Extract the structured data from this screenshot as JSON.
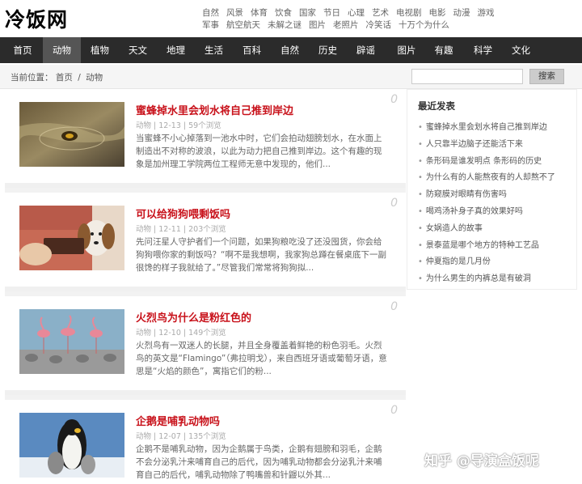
{
  "header": {
    "logo": "冷饭网",
    "top_links": [
      "自然",
      "风景",
      "体育",
      "饮食",
      "国家",
      "节日",
      "心理",
      "艺术",
      "电视剧",
      "电影",
      "动漫",
      "游戏",
      "军事",
      "航空航天",
      "未解之谜",
      "图片",
      "老照片",
      "冷笑话",
      "十万个为什么"
    ]
  },
  "nav": {
    "items": [
      "首页",
      "动物",
      "植物",
      "天文",
      "地理",
      "生活",
      "百科",
      "自然",
      "历史",
      "辟谣",
      "图片",
      "有趣",
      "科学",
      "文化"
    ],
    "active": "动物"
  },
  "breadcrumb": {
    "prefix": "当前位置：",
    "home": "首页",
    "separator": "/",
    "current": "动物"
  },
  "search": {
    "placeholder": "",
    "button_label": "搜索"
  },
  "posts": [
    {
      "title": "蜜蜂掉水里会划水将自己推到岸边",
      "category": "动物",
      "date": "12-13",
      "views": "59个浏览",
      "desc": "当蜜蜂不小心掉落到一池水中时，它们会拍动翅膀划水，在水面上制造出不对称的波浪，以此为动力把自己推到岸边。这个有趣的现象是加州理工学院两位工程师无意中发现的，他们...",
      "count": "0"
    },
    {
      "title": "可以给狗狗喂剩饭吗",
      "category": "动物",
      "date": "12-11",
      "views": "203个浏览",
      "desc": "先问汪星人守护者们一个问题，如果狗粮吃没了还没囤货，你会给狗狗喂你家的剩饭吗？“啊不是我想啊，我家狗总蹲在餐桌底下一副很馋的样子我就给了。”尽管我们常常将狗狗拟...",
      "count": "0"
    },
    {
      "title": "火烈鸟为什么是粉红色的",
      "category": "动物",
      "date": "12-10",
      "views": "149个浏览",
      "desc": "火烈鸟有一双迷人的长腿，并且全身覆盖着鲜艳的粉色羽毛。火烈鸟的英文是“Flamingo”（弗拉明戈），来自西班牙语或葡萄牙语，意思是“火焰的颜色”，寓指它们的粉...",
      "count": "0"
    },
    {
      "title": "企鹅是哺乳动物吗",
      "category": "动物",
      "date": "12-07",
      "views": "135个浏览",
      "desc": "企鹅不是哺乳动物，因为企鹅属于鸟类，企鹅有翅膀和羽毛，企鹅不会分泌乳汁来哺育自己的后代，因为哺乳动物都会分泌乳汁来哺育自己的后代，哺乳动物除了鸭嘴兽和针鼹以外其...",
      "count": "0"
    }
  ],
  "sidebar": {
    "title": "最近发表",
    "items": [
      "蜜蜂掉水里会划水将自己推到岸边",
      "人只靠半边脑子还能活下来",
      "条形码是谁发明点 条形码的历史",
      "为什么有的人能熬夜有的人却熬不了",
      "防窥膜对眼睛有伤害吗",
      "喝鸡汤补身子真的效果好吗",
      "女娲造人的故事",
      "景泰蓝是哪个地方的特种工艺品",
      "仲夏指的是几月份",
      "为什么男生的内裤总是有破洞"
    ]
  },
  "watermark": "知乎 @导演盒饭呢"
}
